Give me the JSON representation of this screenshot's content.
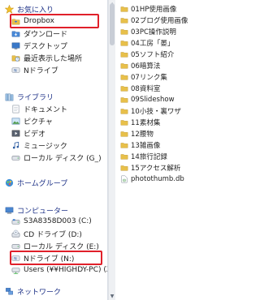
{
  "nav": {
    "favorites": {
      "label": "お気に入り",
      "items": [
        {
          "label": "Dropbox",
          "icon": "dropbox-icon"
        },
        {
          "label": "ダウンロード",
          "icon": "downloads-folder-icon"
        },
        {
          "label": "デスクトップ",
          "icon": "desktop-icon"
        },
        {
          "label": "最近表示した場所",
          "icon": "recent-places-icon"
        },
        {
          "label": "Nドライブ",
          "icon": "network-drive-icon"
        }
      ]
    },
    "libraries": {
      "label": "ライブラリ",
      "items": [
        {
          "label": "ドキュメント",
          "icon": "documents-icon"
        },
        {
          "label": "ピクチャ",
          "icon": "pictures-icon"
        },
        {
          "label": "ビデオ",
          "icon": "videos-icon"
        },
        {
          "label": "ミュージック",
          "icon": "music-icon"
        },
        {
          "label": "ローカル ディスク (G_)",
          "icon": "drive-icon"
        }
      ]
    },
    "homegroup": {
      "label": "ホームグループ"
    },
    "computer": {
      "label": "コンピューター",
      "items": [
        {
          "label": "S3A8358D003 (C:)",
          "icon": "drive-icon"
        },
        {
          "label": "CD ドライブ (D:)",
          "icon": "cd-drive-icon"
        },
        {
          "label": "ローカル ディスク (E:)",
          "icon": "drive-icon"
        },
        {
          "label": "Nドライブ (N:)",
          "icon": "network-drive-icon"
        },
        {
          "label": "Users (¥¥HIGHDY-PC) (Z:)",
          "icon": "network-drive-icon"
        }
      ]
    },
    "network": {
      "label": "ネットワーク"
    }
  },
  "files": [
    "01HP使用画像",
    "02ブログ使用画像",
    "03PC操作説明",
    "04工房「晏」",
    "05ソフト紹介",
    "06暗算法",
    "07リンク集",
    "08資料室",
    "09Slideshow",
    "10小技・裏ワザ",
    "11素材集",
    "12腰物",
    "13雑画像",
    "14旅行記録",
    "15アクセス解析",
    "photothumb.db"
  ],
  "colors": {
    "highlight_border": "#e0202a",
    "folder_yellow": "#e8c04a",
    "group_label": "#1e3287"
  }
}
